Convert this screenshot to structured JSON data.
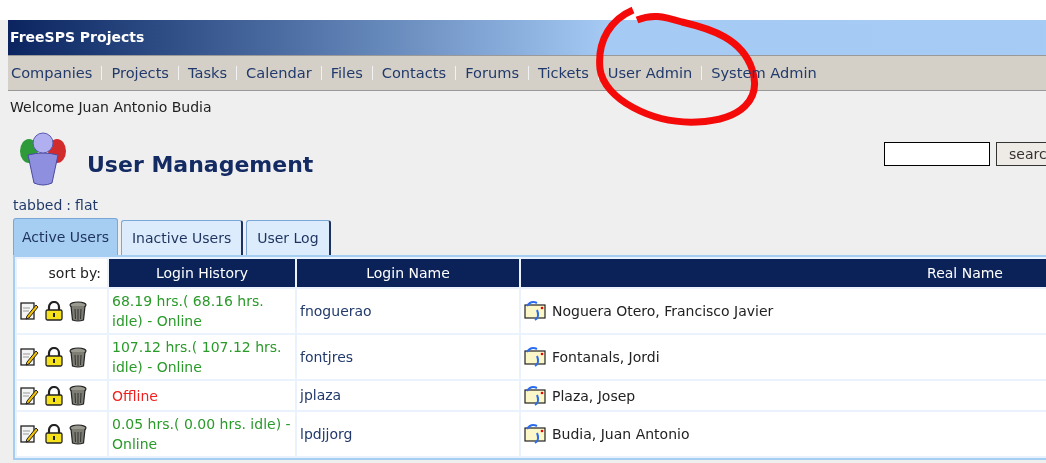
{
  "window": {
    "title": "FreeSPS Projects"
  },
  "nav": [
    "Companies",
    "Projects",
    "Tasks",
    "Calendar",
    "Files",
    "Contacts",
    "Forums",
    "Tickets",
    "User Admin",
    "System Admin"
  ],
  "welcome": "Welcome Juan Antonio Budia",
  "page_title": "User Management",
  "search": {
    "button": "searc"
  },
  "view_switch": {
    "options": [
      "tabbed",
      "flat"
    ],
    "separator": ":"
  },
  "tabs": [
    {
      "label": "Active Users",
      "selected": true
    },
    {
      "label": "Inactive Users",
      "selected": false
    },
    {
      "label": "User Log",
      "selected": false
    }
  ],
  "table": {
    "sort_label": "sort by:",
    "columns": [
      "Login History",
      "Login Name",
      "Real Name"
    ],
    "rows": [
      {
        "login_history": "68.19 hrs.( 68.16 hrs. idle) - Online",
        "online": true,
        "login_name": "fnoguerao",
        "real_name": "Noguera Otero, Francisco Javier"
      },
      {
        "login_history": "107.12 hrs.( 107.12 hrs. idle) - Online",
        "online": true,
        "login_name": "fontjres",
        "real_name": "Fontanals, Jordi"
      },
      {
        "login_history": "Offline",
        "online": false,
        "login_name": "jplaza",
        "real_name": "Plaza, Josep"
      },
      {
        "login_history": "0.05 hrs.( 0.00 hrs. idle) - Online",
        "online": true,
        "login_name": "lpdjjorg",
        "real_name": "Budia, Juan Antonio"
      }
    ]
  },
  "annotation": {
    "kind": "circle"
  }
}
